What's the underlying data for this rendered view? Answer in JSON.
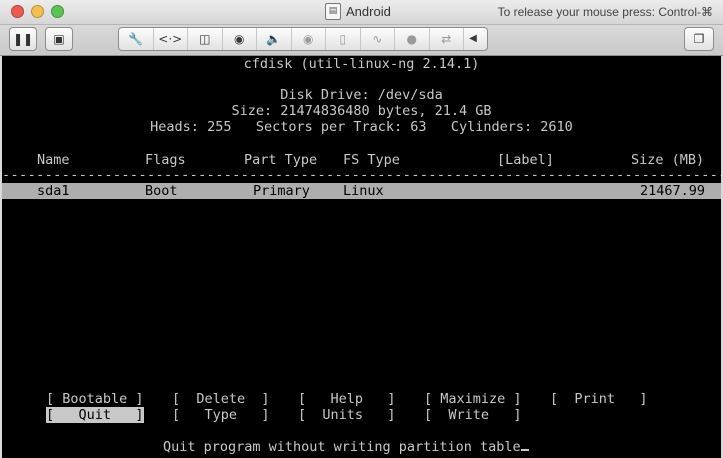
{
  "window": {
    "title": "Android",
    "release_hint": "To release your mouse press: Control-⌘"
  },
  "toolbar": {
    "icons": [
      "wrench-icon",
      "code-icon",
      "disk-icon",
      "hdd-icon",
      "speaker-icon",
      "camera-icon",
      "mouse-icon",
      "network-icon",
      "bluetooth-icon",
      "usb-icon",
      "arrow-left-icon"
    ]
  },
  "console": {
    "program": "cfdisk (util-linux-ng 2.14.1)",
    "disk_drive": "Disk Drive: /dev/sda",
    "size": "Size: 21474836480 bytes, 21.4 GB",
    "geometry": "Heads: 255   Sectors per Track: 63   Cylinders: 2610",
    "columns": {
      "name": "Name",
      "flags": "Flags",
      "part_type": "Part Type",
      "fs_type": "FS Type",
      "label": "[Label]",
      "size": "Size (MB)"
    },
    "partitions": [
      {
        "name": "sda1",
        "flags": "Boot",
        "part_type": "Primary",
        "fs_type": "Linux",
        "size": "21467.99"
      }
    ],
    "menu_row1": [
      "[ Bootable ]",
      "[  Delete  ]",
      "[   Help   ]",
      "[ Maximize ]",
      "[  Print   ]"
    ],
    "menu_row2": [
      "[   Quit   ]",
      "[   Type   ]",
      "[  Units   ]",
      "[  Write   ]"
    ],
    "selected_menu": "[   Quit   ]",
    "status": "Quit program without writing partition table"
  }
}
